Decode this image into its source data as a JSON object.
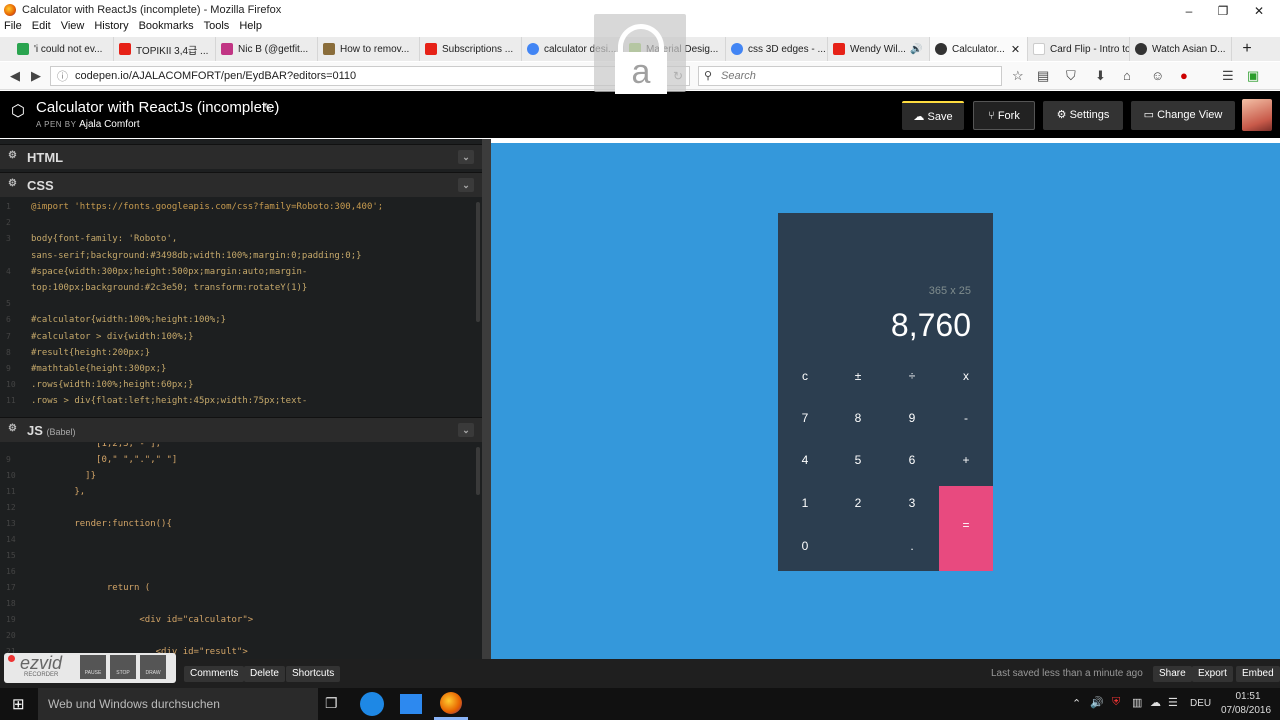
{
  "window": {
    "title": "Calculator with ReactJs (incomplete) - Mozilla Firefox",
    "controls": [
      "–",
      "❐",
      "✕"
    ]
  },
  "menu": [
    "File",
    "Edit",
    "View",
    "History",
    "Bookmarks",
    "Tools",
    "Help"
  ],
  "tabs": [
    {
      "label": "'i could not ev...",
      "color": "#2aa44f"
    },
    {
      "label": "TOPIKII 3,4급 ...",
      "color": "#e62117"
    },
    {
      "label": "Nic B (@getfit...",
      "color": "#c13584"
    },
    {
      "label": "How to remov...",
      "color": "#8a6d3b"
    },
    {
      "label": "Subscriptions ...",
      "color": "#e62117"
    },
    {
      "label": "calculator desi...",
      "color": "#4285f4"
    },
    {
      "label": "Material Desig...",
      "color": "#8bc34a"
    },
    {
      "label": "css 3D edges - ...",
      "color": "#4285f4"
    },
    {
      "label": "Wendy Wil...",
      "color": "#e62117"
    },
    {
      "label": "Calculator...",
      "color": "#333333",
      "active": true
    },
    {
      "label": "Card Flip - Intro to ...",
      "color": "#ffffff"
    },
    {
      "label": "Watch Asian D...",
      "color": "#333333"
    }
  ],
  "nav": {
    "url": "codepen.io/AJALACOMFORT/pen/EydBAR?editors=0110",
    "search_placeholder": "Search"
  },
  "pen": {
    "title": "Calculator with ReactJs (incomplete)",
    "by_label": "A PEN BY",
    "author": "Ajala Comfort",
    "buttons": {
      "save": "Save",
      "fork": "Fork",
      "settings": "Settings",
      "change_view": "Change View"
    }
  },
  "panes": {
    "html": "HTML",
    "css": "CSS",
    "js": "JS",
    "js_sub": "(Babel)"
  },
  "css_lines": [
    {
      "n": "1",
      "t": "@import 'https://fonts.googleapis.com/css?family=Roboto:300,400';"
    },
    {
      "n": "2",
      "t": ""
    },
    {
      "n": "3",
      "t": "body{font-family: 'Roboto',"
    },
    {
      "n": "",
      "t": "sans-serif;background:#3498db;width:100%;margin:0;padding:0;}"
    },
    {
      "n": "4",
      "t": "#space{width:300px;height:500px;margin:auto;margin-"
    },
    {
      "n": "",
      "t": "top:100px;background:#2c3e50; transform:rotateY(1)}"
    },
    {
      "n": "5",
      "t": ""
    },
    {
      "n": "6",
      "t": "#calculator{width:100%;height:100%;}"
    },
    {
      "n": "7",
      "t": "#calculator > div{width:100%;}"
    },
    {
      "n": "8",
      "t": "#result{height:200px;}"
    },
    {
      "n": "9",
      "t": "#mathtable{height:300px;}"
    },
    {
      "n": "10",
      "t": ".rows{width:100%;height:60px;}"
    },
    {
      "n": "11",
      "t": ".rows > div{float:left;height:45px;width:75px;text-"
    }
  ],
  "js_lines": [
    {
      "n": "",
      "t": "            [1,2,3,\"-\"],"
    },
    {
      "n": "9",
      "t": "            [0,\" \",\".\",\" \"]"
    },
    {
      "n": "10",
      "t": "          ]}"
    },
    {
      "n": "11",
      "t": "        },"
    },
    {
      "n": "12",
      "t": ""
    },
    {
      "n": "13",
      "t": "        render:function(){"
    },
    {
      "n": "14",
      "t": ""
    },
    {
      "n": "15",
      "t": ""
    },
    {
      "n": "16",
      "t": ""
    },
    {
      "n": "17",
      "t": "              return ("
    },
    {
      "n": "18",
      "t": ""
    },
    {
      "n": "19",
      "t": "                    <div id=\"calculator\">"
    },
    {
      "n": "20",
      "t": ""
    },
    {
      "n": "21",
      "t": "                       <div id=\"result\">"
    }
  ],
  "calculator": {
    "dims": "365 x 25",
    "result": "8,760",
    "keys": [
      [
        "c",
        "±",
        "÷",
        "x"
      ],
      [
        "7",
        "8",
        "9",
        "-"
      ],
      [
        "4",
        "5",
        "6",
        "+"
      ],
      [
        "1",
        "2",
        "3",
        "="
      ],
      [
        "0",
        "",
        ".",
        ""
      ]
    ],
    "equals_color": "#e84a7f"
  },
  "bottom": {
    "comments": "Comments",
    "delete": "Delete",
    "shortcuts": "Shortcuts",
    "saved": "Last saved less than a minute ago",
    "share": "Share",
    "export": "Export",
    "embed": "Embed",
    "recorder": "ezvid",
    "recorder_sub": "RECORDER",
    "rec_buttons": [
      "PAUSE",
      "STOP",
      "DRAW"
    ]
  },
  "taskbar": {
    "search": "Web und Windows durchsuchen",
    "lang": "DEU",
    "time": "01:51",
    "date": "07/08/2016"
  },
  "overlay_letter": "a"
}
